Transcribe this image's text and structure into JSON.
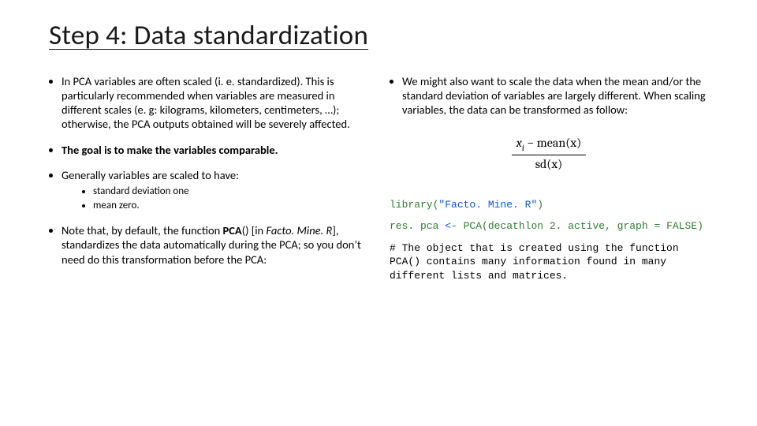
{
  "title": "Step 4: Data standardization",
  "left": {
    "b1": "In PCA variables are often scaled (i. e. standardized). This is particularly recommended when variables are measured in different scales (e. g: kilograms, kilometers, centimeters, …); otherwise, the PCA outputs obtained will be severely affected.",
    "b2": "The goal is to make the variables comparable.",
    "b3": "Generally variables are scaled to have:",
    "sub1": "standard deviation one",
    "sub2": "mean zero.",
    "b4_pre": "Note that, by default, the function ",
    "b4_pca": "PCA",
    "b4_paren": "() [in ",
    "b4_pkg": "Facto. Mine. R",
    "b4_post": "], standardizes the data automatically during the PCA; so you don’t need do this transformation before the PCA:"
  },
  "right": {
    "b1": "We might also want to scale the data when the mean and/or the standard deviation of variables are largely different. When scaling variables, the data can be transformed as follow:",
    "formula_num_a": "x",
    "formula_num_i": "i",
    "formula_num_b": " − mean(x)",
    "formula_den": "sd(x)",
    "code_lib_a": "library(",
    "code_lib_b": "\"Facto. Mine. R\"",
    "code_lib_c": ")",
    "code_pca_lhs": "res. pca ",
    "code_pca_arrow": "<- ",
    "code_pca_rhs": "PCA(decathlon 2. active, graph = FALSE)",
    "code_comment": "# The object that is created using the function PCA() contains many information found in many different lists and matrices."
  }
}
